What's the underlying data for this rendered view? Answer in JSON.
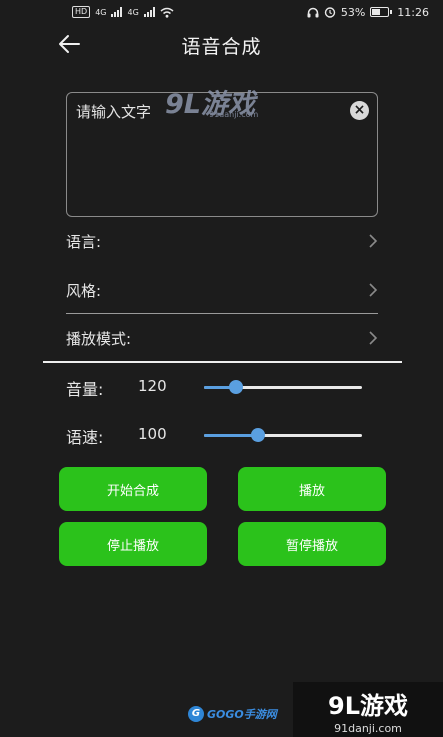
{
  "status_bar": {
    "badge": "HD",
    "network_left": "4G",
    "network_right": "4G",
    "battery_percent": 53,
    "battery_label": "53%",
    "time": "11:26"
  },
  "header": {
    "title": "语音合成"
  },
  "text_input": {
    "placeholder": "请输入文字",
    "value": "",
    "clear_symbol": "×"
  },
  "settings": [
    {
      "label": "语言:"
    },
    {
      "label": "风格:"
    },
    {
      "label": "播放模式:"
    }
  ],
  "sliders": {
    "volume": {
      "label": "音量:",
      "value": "120",
      "fraction": 0.2
    },
    "speed": {
      "label": "语速:",
      "value": "100",
      "fraction": 0.34
    }
  },
  "buttons": {
    "start_synthesis": "开始合成",
    "play": "播放",
    "stop_play": "停止播放",
    "pause_play": "暂停播放"
  },
  "watermarks": {
    "top_logo": "9L游戏",
    "top_url": "91danji.com",
    "bottom_left": "GOGO手游网",
    "bottom_right_logo": "9L游戏",
    "bottom_right_url": "91danji.com"
  },
  "colors": {
    "background": "#1c1c1c",
    "button_green": "#2bc21b",
    "slider_accent": "#5a9fe0"
  },
  "icons": {
    "back": "back-arrow-icon",
    "clear": "clear-icon",
    "chevron": "chevron-right-icon"
  }
}
